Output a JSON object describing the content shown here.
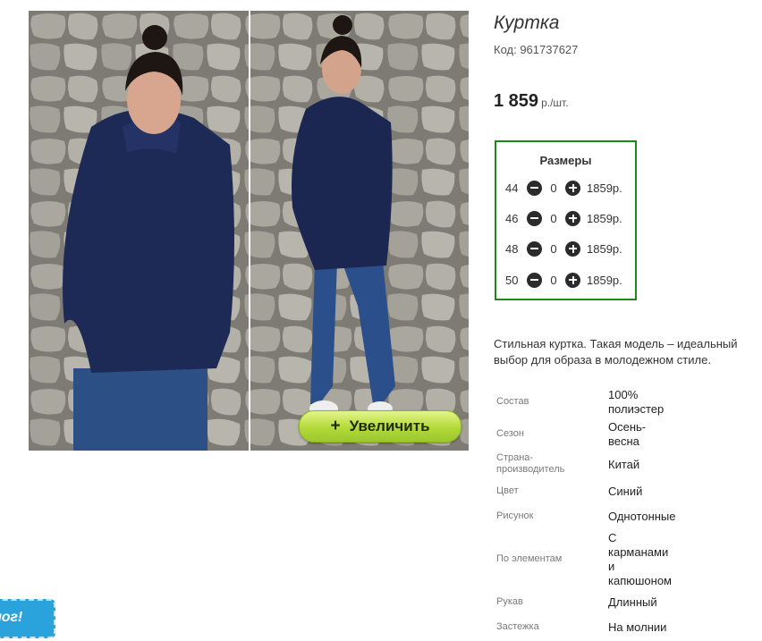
{
  "product": {
    "title": "Куртка",
    "code": "Код: 961737627",
    "price": "1 859",
    "price_unit": "р./шт.",
    "zoom_label": "Увеличить",
    "zoom_icon": "plus-icon"
  },
  "sizes": {
    "title": "Размеры",
    "rows": [
      {
        "size": "44",
        "qty": "0",
        "price": "1859р."
      },
      {
        "size": "46",
        "qty": "0",
        "price": "1859р."
      },
      {
        "size": "48",
        "qty": "0",
        "price": "1859р."
      },
      {
        "size": "50",
        "qty": "0",
        "price": "1859р."
      }
    ]
  },
  "description": "Стильная куртка. Такая модель – идеальный выбор для образа в молодежном стиле.",
  "properties": [
    {
      "label": "Состав",
      "value": "100%\nполиэстер"
    },
    {
      "label": "Сезон",
      "value": "Осень-\nвесна"
    },
    {
      "label": "Страна-\nпроизводитель",
      "value": "Китай"
    },
    {
      "label": "Цвет",
      "value": "Синий"
    },
    {
      "label": "Рисунок",
      "value": "Однотонные"
    },
    {
      "label": "По элементам",
      "value": "С\nкарманами\nи\nкапюшоном"
    },
    {
      "label": "Рукав",
      "value": "Длинный"
    },
    {
      "label": "Застежка",
      "value": "На молнии"
    }
  ],
  "catalog_tab": {
    "label": "лог!"
  },
  "colors": {
    "sizes_border": "#1a8a1a",
    "zoom_button": "#b2d93a",
    "catalog_tab": "#2aa3dc"
  }
}
